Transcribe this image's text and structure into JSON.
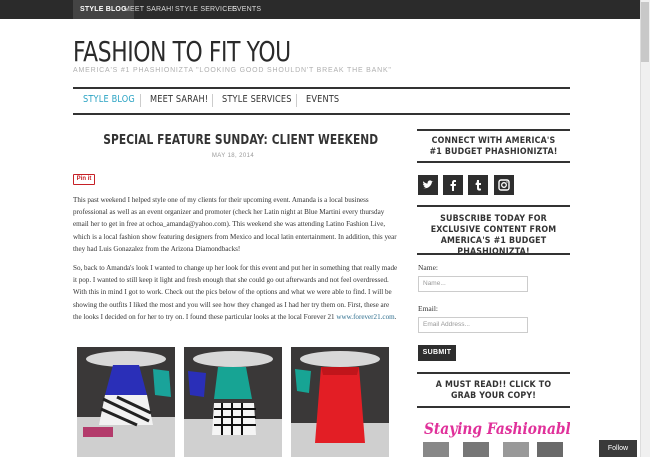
{
  "topbar": {
    "items": [
      "STYLE BLOG",
      "MEET SARAH!",
      "STYLE SERVICES",
      "EVENTS"
    ]
  },
  "site": {
    "title": "FASHION TO FIT YOU",
    "tagline": "AMERICA'S #1 PHASHIONIZTA \"LOOKING GOOD SHOULDN'T BREAK THE BANK\""
  },
  "nav": {
    "items": [
      "STYLE BLOG",
      "MEET SARAH!",
      "STYLE SERVICES",
      "EVENTS"
    ],
    "active": "STYLE BLOG"
  },
  "post": {
    "title": "SPECIAL FEATURE SUNDAY: CLIENT WEEKEND",
    "date": "MAY 18, 2014",
    "pinit": "Pin it",
    "p1": "This past weekend I helped style one of my clients for their upcoming event. Amanda is a local business professional as well as an event organizer and promoter (check her Latin night at Blue Martini every thursday email her to get in free at ochoa_amanda@yahoo.com). This weekend she was attending Latino Fashion Live, which is a local fashion show featuring designers from Mexico and local latin entertainment. In addition, this year they had Luis Gonazalez from the Arizona Diamondbacks!",
    "p2_main": "So, back to Amanda's look I wanted to change up her look for this event and put her in something that really made it pop. I wanted to still keep it light and fresh enough that she could go out afterwards and not feel overdressed. With this in mind I got to work. Check out the pics below of the options and what we were able to find. I will be showing the outfits I liked the most and you will see how they changed as I had her try them on. First, these are the looks I decided on for her to try on. I found these particular looks at the local Forever 21",
    "p2_link": "www.forever21.com",
    "p2_end": "."
  },
  "sidebar": {
    "connect_heading": "CONNECT WITH AMERICA'S #1 BUDGET PHASHIONIZTA!",
    "social_icons": [
      "twitter-icon",
      "facebook-icon",
      "tumblr-icon",
      "instagram-icon"
    ],
    "subscribe_heading": "SUBSCRIBE TODAY FOR EXCLUSIVE CONTENT FROM AMERICA'S #1 BUDGET PHASHIONIZTA!",
    "name_label": "Name:",
    "name_placeholder": "Name...",
    "email_label": "Email:",
    "email_placeholder": "Email Address...",
    "submit_label": "SUBMIT",
    "mustread_heading": "A MUST READ!! CLICK TO GRAB YOUR COPY!",
    "book_title": "Staying Fashionable"
  },
  "follow_button": "Follow",
  "colors": {
    "accent": "#2aa3c3",
    "dark": "#2b2b2b",
    "book_pink": "#e0319a"
  }
}
